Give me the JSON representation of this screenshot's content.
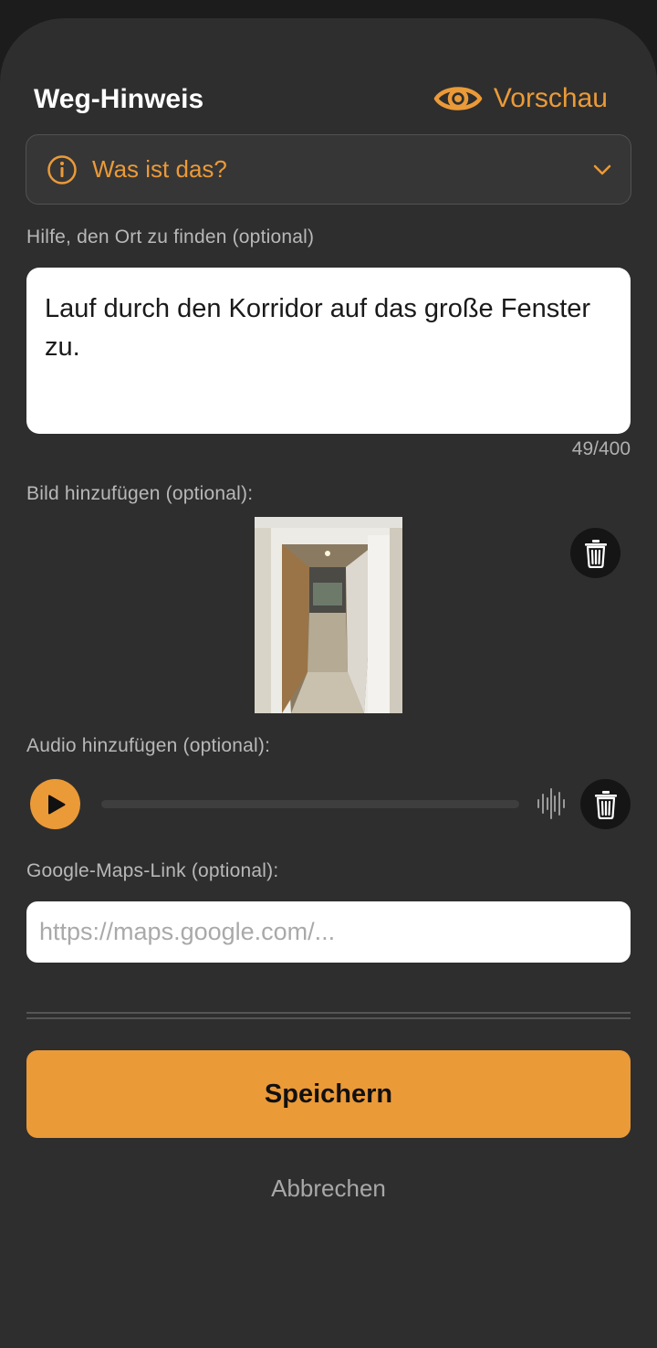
{
  "header": {
    "title": "Weg-Hinweis",
    "preview_label": "Vorschau",
    "preview_icon": "eye-icon"
  },
  "info_select": {
    "label": "Was ist das?",
    "icon": "info-icon"
  },
  "hint": {
    "label": "Hilfe, den Ort zu finden (optional)",
    "value": "Lauf durch den Korridor auf das große Fenster zu.",
    "counter": "49/400"
  },
  "image": {
    "label": "Bild hinzufügen (optional):"
  },
  "audio": {
    "label": "Audio hinzufügen (optional):"
  },
  "maps": {
    "label": "Google-Maps-Link (optional):",
    "placeholder": "https://maps.google.com/..."
  },
  "actions": {
    "save_label": "Speichern",
    "cancel_label": "Abbrechen"
  },
  "colors": {
    "accent": "#eb9a38",
    "sheet_bg": "#2e2e2e"
  }
}
